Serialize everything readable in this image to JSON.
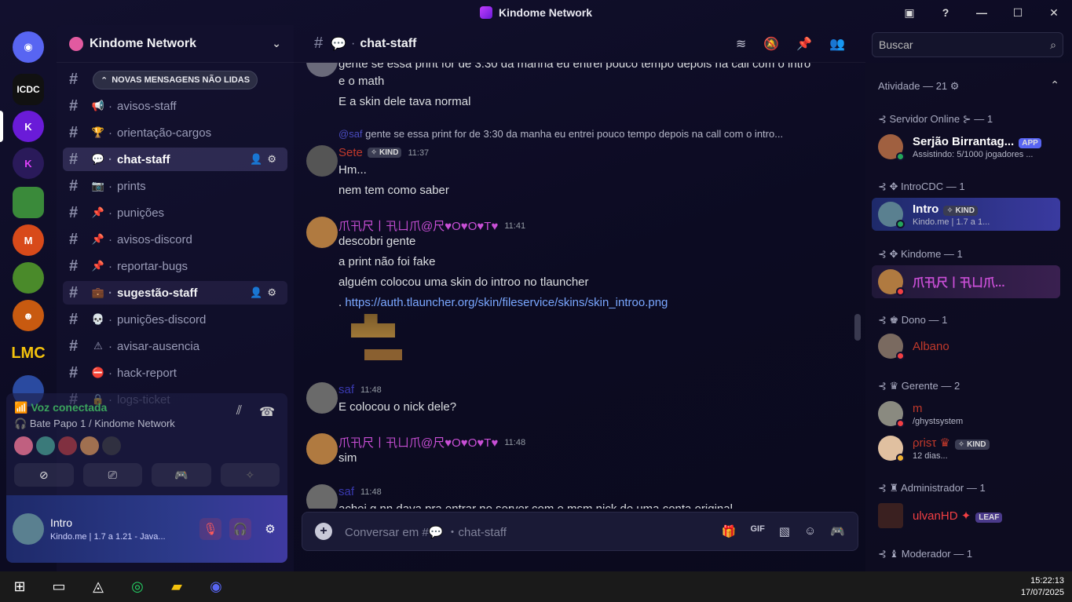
{
  "window": {
    "title": "Kindome Network"
  },
  "server": {
    "name": "Kindome Network",
    "unread_banner": "NOVAS MENSAGENS NÃO LIDAS"
  },
  "guild_labels": [
    "ICDC",
    "LMC"
  ],
  "channels": [
    {
      "name": "avisos-staff",
      "icon": "megaphone-icon",
      "glyph": "📢"
    },
    {
      "name": "orientação-cargos",
      "icon": "trophy-icon",
      "glyph": "🏆"
    },
    {
      "name": "chat-staff",
      "icon": "speech-bubble-icon",
      "glyph": "💬"
    },
    {
      "name": "prints",
      "icon": "camera-icon",
      "glyph": "📷"
    },
    {
      "name": "punições",
      "icon": "pin-icon",
      "glyph": "📌"
    },
    {
      "name": "avisos-discord",
      "icon": "pin-icon",
      "glyph": "📌"
    },
    {
      "name": "reportar-bugs",
      "icon": "pin-icon",
      "glyph": "📌"
    },
    {
      "name": "sugestão-staff",
      "icon": "briefcase-icon",
      "glyph": "💼"
    },
    {
      "name": "punições-discord",
      "icon": "skull-icon",
      "glyph": "💀"
    },
    {
      "name": "avisar-ausencia",
      "icon": "warning-icon",
      "glyph": "⚠"
    },
    {
      "name": "hack-report",
      "icon": "no-entry-icon",
      "glyph": "⛔"
    },
    {
      "name": "logs-ticket",
      "icon": "lock-icon",
      "glyph": "🔒"
    }
  ],
  "voice": {
    "status": "Voz conectada",
    "channel": "Bate Papo 1 / Kindome Network"
  },
  "user": {
    "name": "Intro",
    "status": "Kindo.me | 1.7 a 1.21 - Java..."
  },
  "chat": {
    "channel": "chat-staff",
    "search_placeholder": "Buscar",
    "composer_placeholder": "Conversar em #💬 ・chat-staff"
  },
  "messages": {
    "top1": "gente se essa print for de 3:30 da manha eu entrei pouco tempo depois na call com o intro",
    "top2": "e o math",
    "top3": "E a skin dele tava normal",
    "reply_name": "@saf",
    "reply_text": "gente se essa print for de 3:30 da manha eu entrei pouco tempo depois na call com o intro...",
    "m1_author": "Sete",
    "m1_tag": "✧ KIND",
    "m1_time": "11:37",
    "m1_l1": "Hm...",
    "m1_l2": "nem tem como saber",
    "m2_author": "爪卂尺丨卂ㄩ爪@尺♥O♥O♥T♥",
    "m2_time": "11:41",
    "m2_l1": "descobri gente",
    "m2_l2": "a print não foi fake",
    "m2_l3": "alguém colocou uma skin do introo no tlauncher",
    "m2_prefix": ". ",
    "m2_link": "https://auth.tlauncher.org/skin/fileservice/skins/skin_introo.png",
    "m3_author": "saf",
    "m3_time": "11:48",
    "m3_l1": "E colocou o nick dele?",
    "m4_author": "爪卂尺丨卂ㄩ爪@尺♥O♥O♥T♥",
    "m4_time": "11:48",
    "m4_l1": "sim",
    "m5_author": "saf",
    "m5_time": "11:48",
    "m5_l1": "achei q nn dava pra entrar no server com o msm nick de uma conta original"
  },
  "members": {
    "activity": "Atividade — 21",
    "g1": "⊰ Servidor Online ⊱ — 1",
    "u1_name": "Serjão Birrantag...",
    "u1_tag": "APP",
    "u1_status": "Assistindo: 5/1000 jogadores ...",
    "g2": "⊰ ✥ IntroCDC — 1",
    "u2_name": "Intro",
    "u2_tag": "✧ KIND",
    "u2_status": "Kindo.me | 1.7 a 1...",
    "g3": "⊰ ✥ Kindome — 1",
    "u3_name": "爪卂尺丨卂ㄩ爪...",
    "g4": "⊰ ♚ Dono — 1",
    "u4_name": "Albano",
    "g5": "⊰ ♛ Gerente — 2",
    "u5_name": "m",
    "u5_status": "/ghystsystem",
    "u6_name": "ρrisτ ♛",
    "u6_tag": "✧ KIND",
    "u6_status": "12 dias...",
    "g6": "⊰ ♜ Administrador — 1",
    "u7_name": "ulvanHD ✦",
    "u7_tag": "LEAF",
    "g7": "⊰ ♝ Moderador — 1"
  },
  "clock": {
    "time": "15:22:13",
    "date": "17/07/2025"
  },
  "colors": {
    "accent": "#5865f2",
    "online": "#23a55a",
    "dnd": "#f23f43",
    "pink_name": "#c94fd6",
    "red_name": "#c0392b"
  }
}
